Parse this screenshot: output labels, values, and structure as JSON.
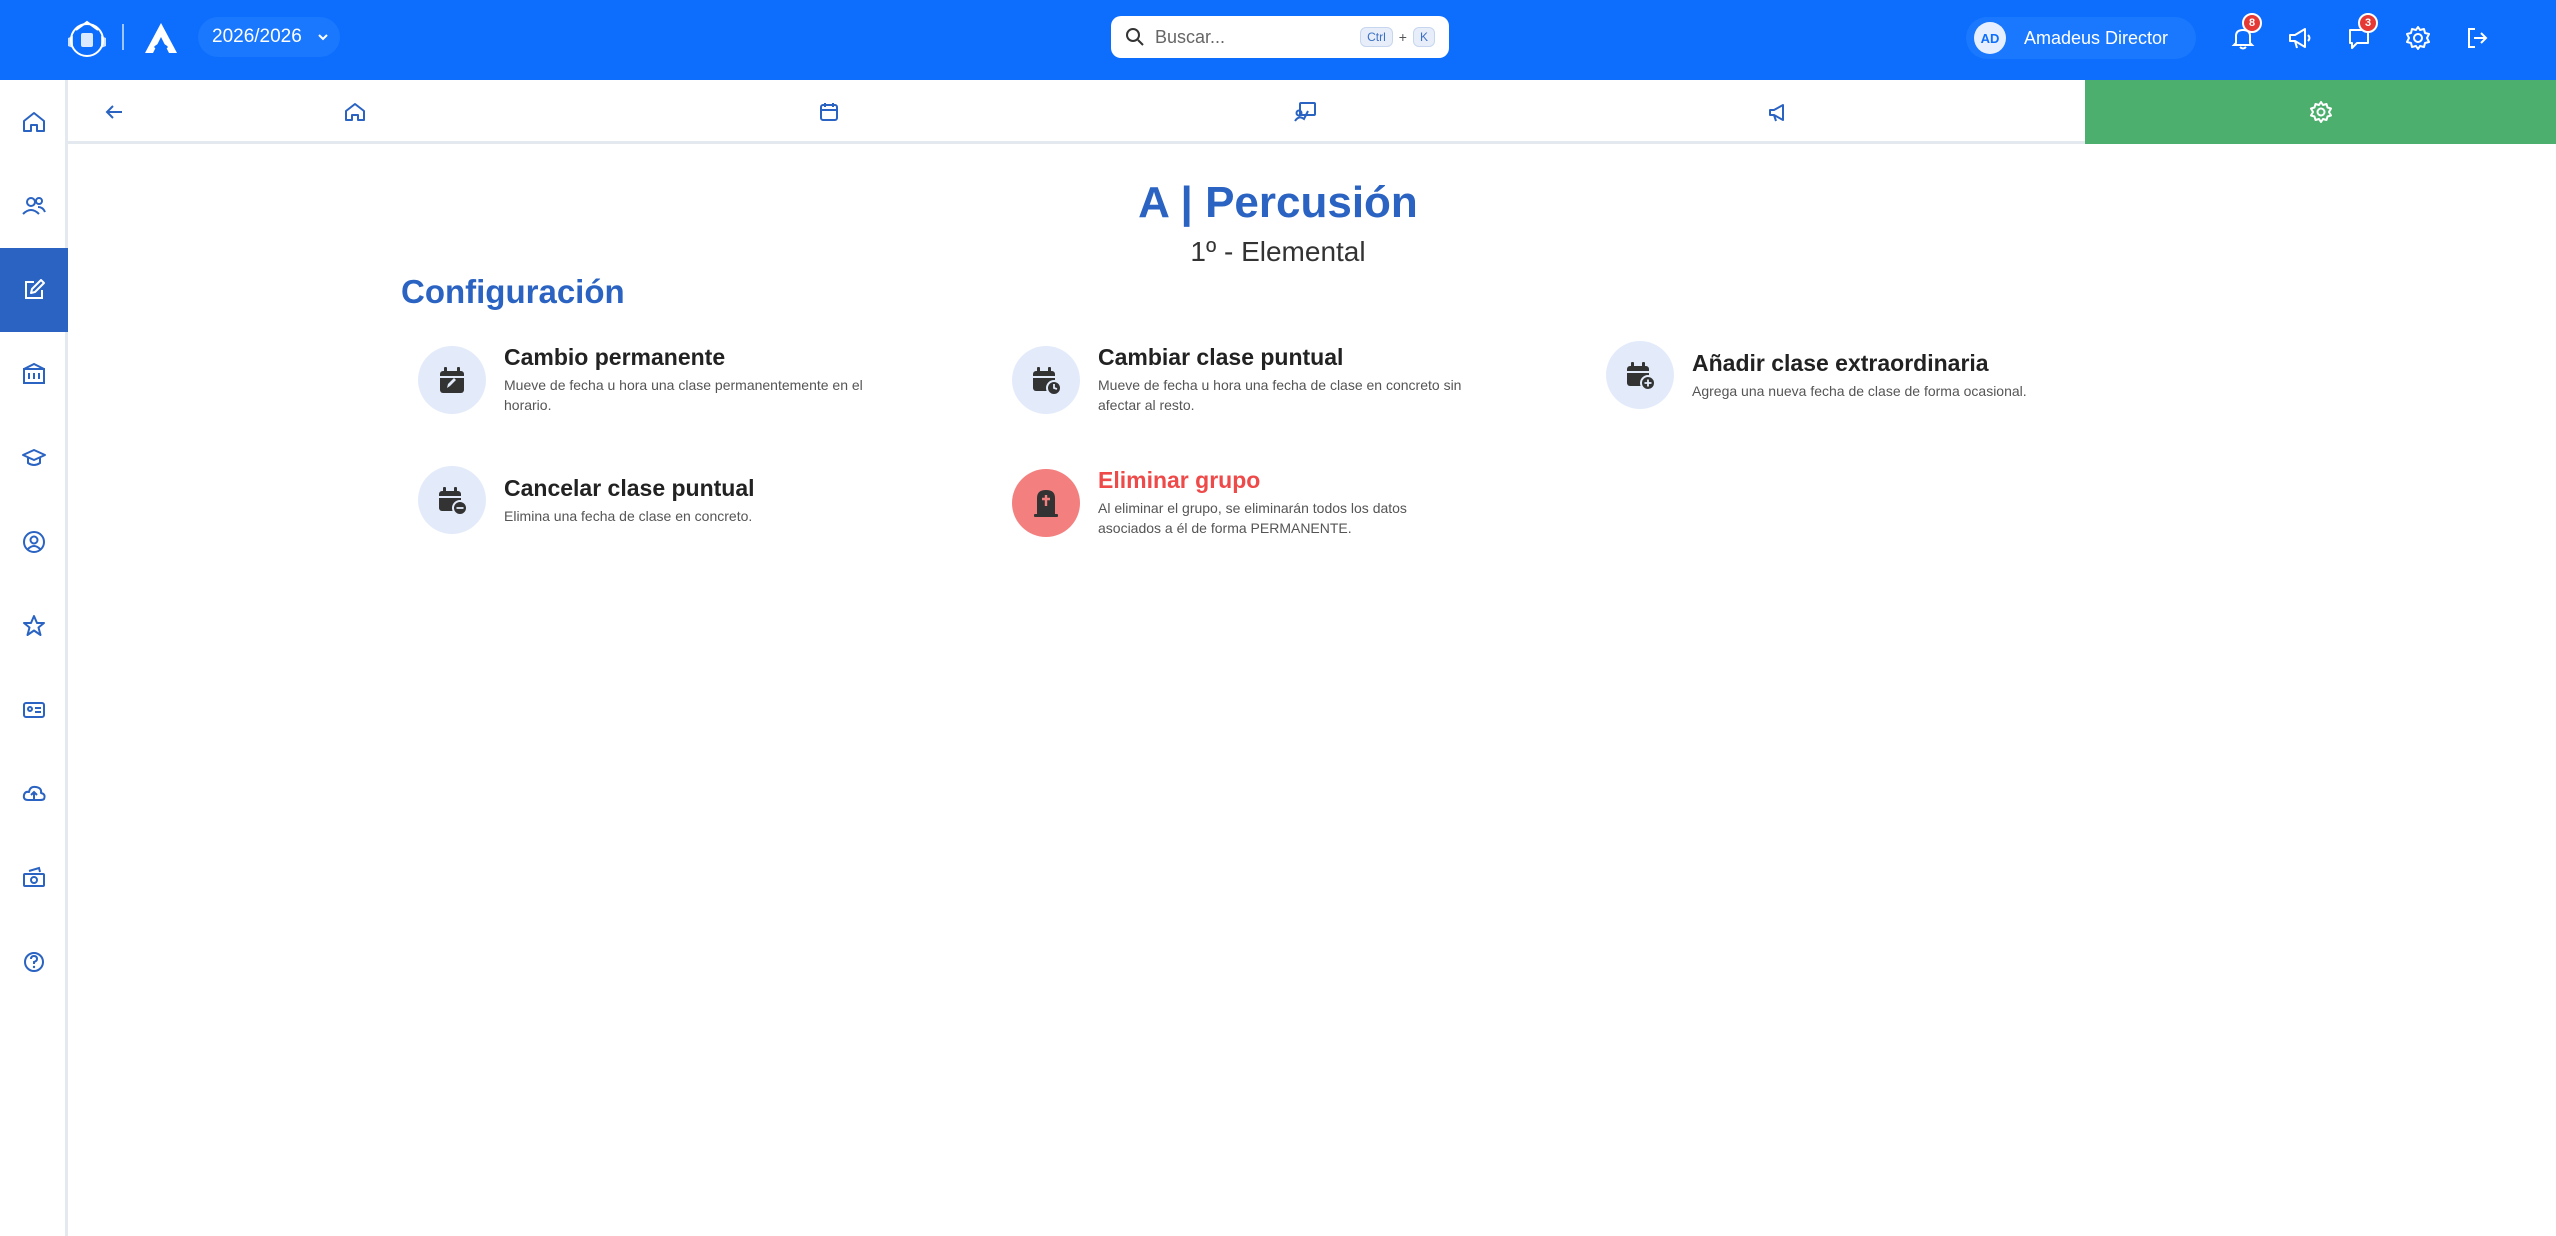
{
  "topbar": {
    "year_selector": "2026/2026",
    "search": {
      "placeholder": "Buscar...",
      "shortcut_ctrl": "Ctrl",
      "shortcut_plus": "+",
      "shortcut_key": "K"
    },
    "user": {
      "initials": "AD",
      "name": "Amadeus Director"
    },
    "notifications_count": "8",
    "messages_count": "3"
  },
  "sidebar": {
    "items": [
      "home-icon",
      "users-icon",
      "edit-icon",
      "building-icon",
      "graduation-cap-icon",
      "user-circle-icon",
      "star-icon",
      "id-card-icon",
      "cloud-upload-icon",
      "money-icon",
      "help-icon"
    ],
    "active_index": 2
  },
  "subnav": {
    "tabs": [
      "home-icon",
      "calendar-icon",
      "teacher-board-icon",
      "megaphone-icon",
      "gear-icon"
    ],
    "active_index": 4
  },
  "main": {
    "title": "A | Percusión",
    "subtitle": "1º - Elemental",
    "section_title": "Configuración",
    "options": [
      {
        "label": "Cambio permanente",
        "desc": "Mueve de fecha u hora una clase permanentemente en el horario.",
        "icon": "calendar-edit-icon"
      },
      {
        "label": "Cambiar clase puntual",
        "desc": "Mueve de fecha u hora una fecha de clase en concreto sin afectar al resto.",
        "icon": "calendar-clock-icon"
      },
      {
        "label": "Añadir clase extraordinaria",
        "desc": "Agrega una nueva fecha de clase de forma ocasional.",
        "icon": "calendar-plus-icon"
      },
      {
        "label": "Cancelar clase puntual",
        "desc": "Elimina una fecha de clase en concreto.",
        "icon": "calendar-minus-icon"
      },
      {
        "label": "Eliminar grupo",
        "desc": "Al eliminar el grupo, se eliminarán todos los datos asociados a él de forma PERMANENTE.",
        "icon": "tombstone-icon",
        "danger": true
      }
    ]
  },
  "colors": {
    "primary": "#0d6efd",
    "accent": "#2a63c2",
    "active_tab": "#4caf6e",
    "danger": "#ef4a4a"
  }
}
